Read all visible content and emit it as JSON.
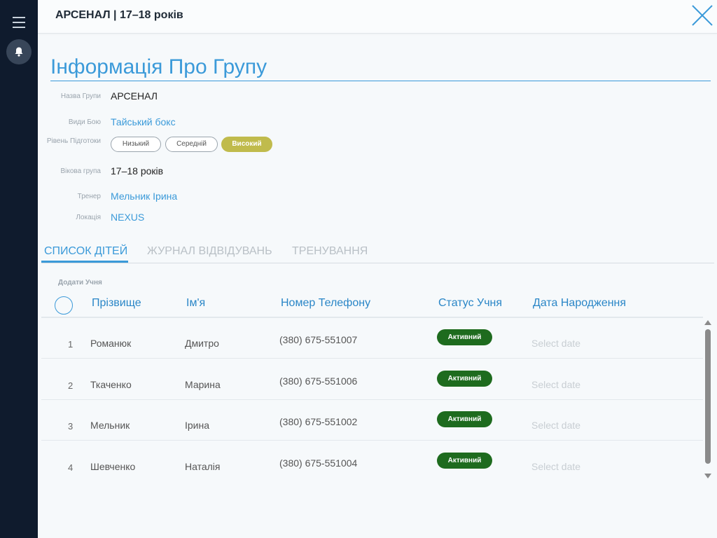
{
  "window": {
    "title": "АРСЕНАЛ | 17–18 років"
  },
  "section": {
    "title": "Інформація Про Групу"
  },
  "info": [
    {
      "label": "Назва Групи",
      "value": "АРСЕНАЛ",
      "link": false
    },
    {
      "label": "Види Бою",
      "value": "Тайський бокс",
      "link": true
    },
    {
      "label": "Рівень Підготоки",
      "value": "",
      "link": false
    },
    {
      "label": "Вікова група",
      "value": "17–18 років",
      "link": false
    },
    {
      "label": "Тренер",
      "value": "Мельник Ірина",
      "link": true
    },
    {
      "label": "Локація",
      "value": "NEXUS",
      "link": true
    }
  ],
  "levels": [
    {
      "label": "Низький",
      "active": false
    },
    {
      "label": "Середній",
      "active": false
    },
    {
      "label": "Високий",
      "active": true
    }
  ],
  "tabs": [
    {
      "label": "СПИСОК ДІТЕЙ",
      "active": true
    },
    {
      "label": "ЖУРНАЛ ВІДВІДУВАНЬ",
      "active": false
    },
    {
      "label": "ТРЕНУВАННЯ",
      "active": false
    }
  ],
  "table": {
    "add_label": "Додати Учня",
    "columns": [
      "Прізвище",
      "Ім'я",
      "Номер Телефону",
      "Статус Учня",
      "Дата Народження"
    ],
    "rows": [
      {
        "num": "1",
        "surname": "Романюк",
        "name": "Дмитро",
        "phone": "(380) 675-551007",
        "status": "Активний",
        "dob": "Select date"
      },
      {
        "num": "2",
        "surname": "Ткаченко",
        "name": "Марина",
        "phone": "(380) 675-551006",
        "status": "Активний",
        "dob": "Select date"
      },
      {
        "num": "3",
        "surname": "Мельник",
        "name": "Ірина",
        "phone": "(380) 675-551002",
        "status": "Активний",
        "dob": "Select date"
      },
      {
        "num": "4",
        "surname": "Шевченко",
        "name": "Наталія",
        "phone": "(380) 675-551004",
        "status": "Активний",
        "dob": "Select date"
      }
    ]
  },
  "colors": {
    "accent": "#3b9ad9",
    "sidebar": "#0f1b2d",
    "level_active": "#c0bb4c",
    "status_active": "#1e6b1e"
  },
  "icons": {
    "menu": "hamburger-menu-icon",
    "notifications": "bell-icon",
    "close": "close-icon"
  }
}
